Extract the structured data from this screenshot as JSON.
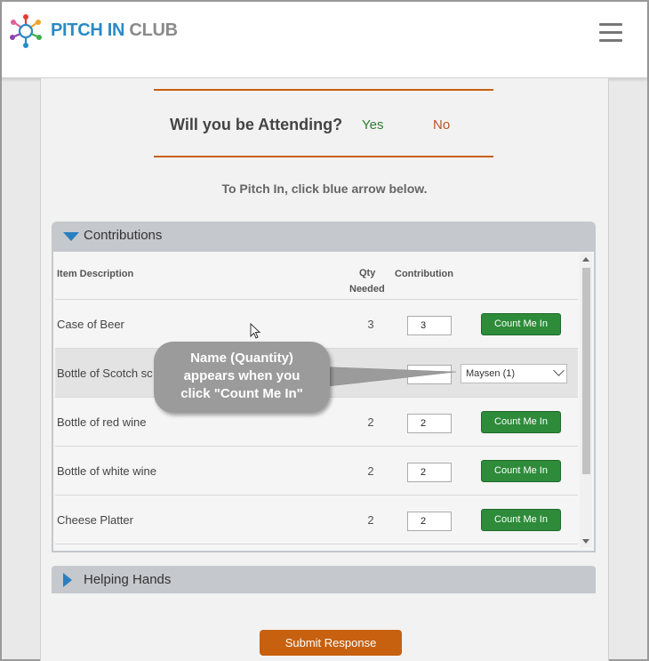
{
  "brand": {
    "part1": "PITCH IN",
    "part2": " CLUB"
  },
  "attending": {
    "question": "Will you be Attending?",
    "yes": "Yes",
    "no": "No"
  },
  "hint": "To Pitch In, click blue arrow below.",
  "contributions": {
    "title": "Contributions",
    "headers": {
      "item": "Item Description",
      "qty_line1": "Qty",
      "qty_line2": "Needed",
      "contribution": "Contribution"
    },
    "rows": [
      {
        "desc": "Case of Beer",
        "qty": "3",
        "contribution": "3",
        "button": "Count Me In"
      },
      {
        "desc": "Bottle of Scotch sc",
        "qty": "",
        "contribution": "",
        "selected": "Maysen (1)"
      },
      {
        "desc": "Bottle of red wine",
        "qty": "2",
        "contribution": "2",
        "button": "Count Me In"
      },
      {
        "desc": "Bottle of white wine",
        "qty": "2",
        "contribution": "2",
        "button": "Count Me In"
      },
      {
        "desc": "Cheese Platter",
        "qty": "2",
        "contribution": "2",
        "button": "Count Me In"
      }
    ]
  },
  "helping_hands": {
    "title": "Helping Hands"
  },
  "callout": {
    "line1": "Name (Quantity)",
    "line2": "appears  when you",
    "line3": "click \"Count Me In\""
  },
  "submit": "Submit Response",
  "colors": {
    "brand_blue": "#2a8bc6",
    "accent_orange": "#c7600f",
    "button_green": "#2e8b3a",
    "expand_blue": "#2a7fc0"
  }
}
